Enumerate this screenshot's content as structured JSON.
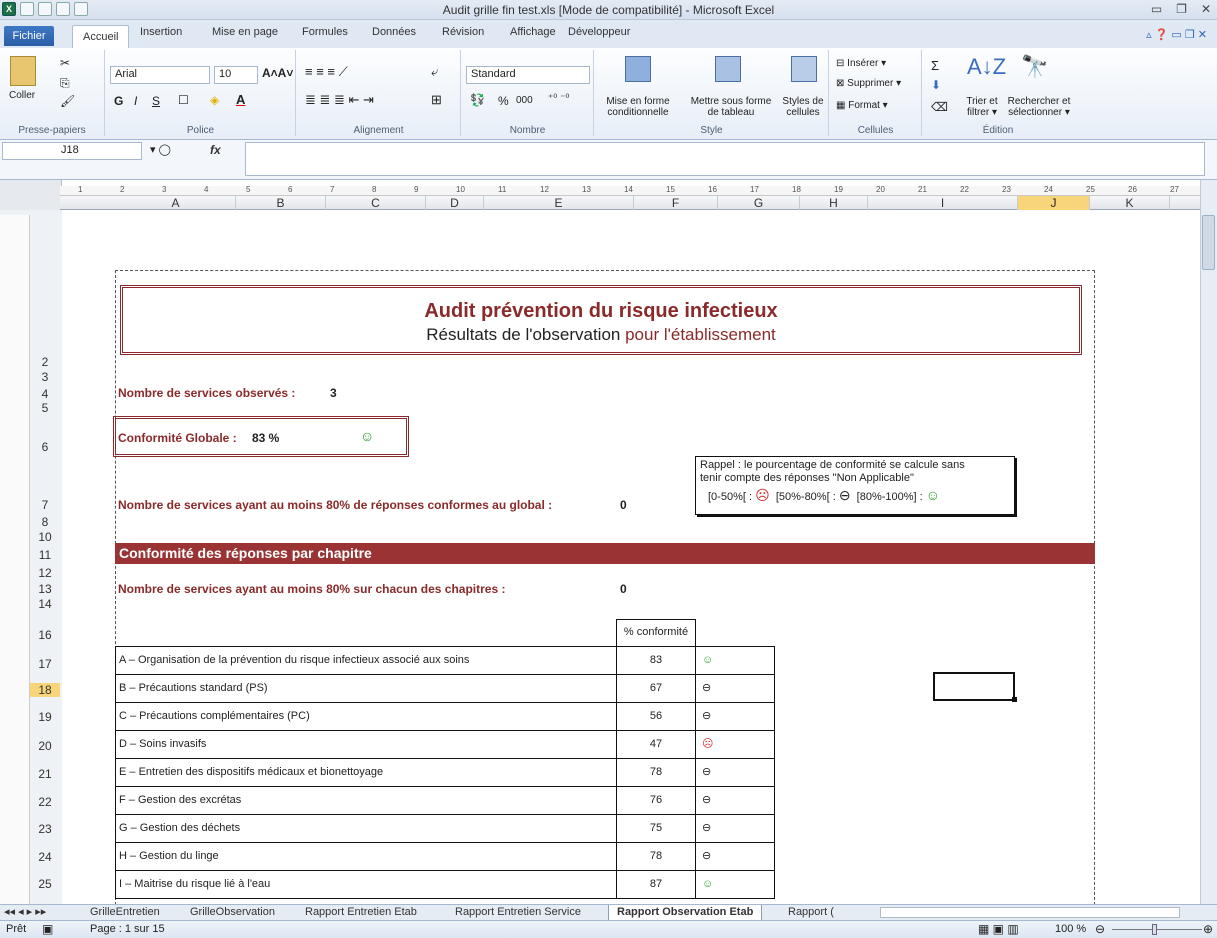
{
  "window": {
    "title": "Audit grille fin test.xls  [Mode de compatibilité]  -  Microsoft Excel"
  },
  "tabs": {
    "file": "Fichier",
    "items": [
      "Accueil",
      "Insertion",
      "Mise en page",
      "Formules",
      "Données",
      "Révision",
      "Affichage",
      "Développeur"
    ]
  },
  "ribbon": {
    "clipboard": {
      "paste": "Coller",
      "label": "Presse-papiers"
    },
    "font": {
      "name": "Arial",
      "size": "10",
      "label": "Police",
      "bold": "G",
      "italic": "I",
      "underline": "S"
    },
    "alignment": {
      "label": "Alignement"
    },
    "number": {
      "format": "Standard",
      "percent": "%",
      "thousands": "000",
      "label": "Nombre"
    },
    "style": {
      "conditional": "Mise en forme",
      "conditional2": "conditionnelle",
      "table": "Mettre sous forme",
      "table2": "de tableau",
      "cellstyles": "Styles de",
      "cellstyles2": "cellules",
      "label": "Style"
    },
    "cells": {
      "insert": "Insérer",
      "delete": "Supprimer",
      "format": "Format",
      "label": "Cellules"
    },
    "editing": {
      "sort": "Trier et",
      "sort2": "filtrer",
      "find": "Rechercher et",
      "find2": "sélectionner",
      "label": "Édition",
      "sigma": "Σ"
    }
  },
  "formula": {
    "namebox": "J18",
    "fx": "fx",
    "value": ""
  },
  "columns": [
    "A",
    "B",
    "C",
    "D",
    "E",
    "F",
    "G",
    "H",
    "I",
    "J",
    "K"
  ],
  "ruler_h": [
    "1",
    "2",
    "3",
    "4",
    "5",
    "6",
    "7",
    "8",
    "9",
    "10",
    "11",
    "12",
    "13",
    "14",
    "15",
    "16",
    "17",
    "18",
    "19",
    "20",
    "21",
    "22",
    "23",
    "24",
    "25",
    "26",
    "27"
  ],
  "rows": [
    "2",
    "3",
    "4",
    "5",
    "6",
    "7",
    "8",
    "10",
    "11",
    "12",
    "13",
    "14",
    "16",
    "17",
    "18",
    "19",
    "20",
    "21",
    "22",
    "23",
    "24",
    "25"
  ],
  "report": {
    "title": "Audit prévention du risque infectieux",
    "subtitle_a": "Résultats de l'observation ",
    "subtitle_b": "pour l'établissement",
    "services_label": "Nombre de services observés :",
    "services_value": "3",
    "conf_label": "Conformité Globale :",
    "conf_value": "83 %",
    "conf_face": "☺",
    "services80_label": "Nombre de services ayant au moins 80% de réponses conformes au global :",
    "services80_value": "0",
    "rappel_l1": "Rappel : le pourcentage de conformité se calcule sans",
    "rappel_l2": "tenir compte des réponses \"Non Applicable\"",
    "rappel_a": "[0-50%[ :",
    "rappel_b": "[50%-80%[ :",
    "rappel_c": "[80%-100%] :",
    "band": "Conformité des réponses par chapitre",
    "chap80_label": "Nombre de services ayant au moins 80% sur chacun des chapitres :",
    "chap80_value": "0",
    "col_header": "% conformité",
    "chapters": [
      {
        "label": "A – Organisation de la prévention du risque infectieux associé aux soins",
        "value": "83",
        "face": "☺",
        "tone": "green"
      },
      {
        "label": "B – Précautions standard (PS)",
        "value": "67",
        "face": "⊖",
        "tone": "black"
      },
      {
        "label": "C – Précautions complémentaires (PC)",
        "value": "56",
        "face": "⊖",
        "tone": "black"
      },
      {
        "label": "D – Soins invasifs",
        "value": "47",
        "face": "☹",
        "tone": "red"
      },
      {
        "label": "E – Entretien des dispositifs médicaux et bionettoyage",
        "value": "78",
        "face": "⊖",
        "tone": "black"
      },
      {
        "label": "F – Gestion des excrétas",
        "value": "76",
        "face": "⊖",
        "tone": "black"
      },
      {
        "label": "G – Gestion des déchets",
        "value": "75",
        "face": "⊖",
        "tone": "black"
      },
      {
        "label": "H – Gestion du linge",
        "value": "78",
        "face": "⊖",
        "tone": "black"
      },
      {
        "label": "I – Maitrise du risque lié à l'eau",
        "value": "87",
        "face": "☺",
        "tone": "green"
      }
    ]
  },
  "sheets": [
    "GrilleEntretien",
    "GrilleObservation",
    "Rapport Entretien Etab",
    "Rapport Entretien Service",
    "Rapport Observation Etab",
    "Rapport ("
  ],
  "status": {
    "ready": "Prêt",
    "page": "Page : 1 sur 15",
    "zoom": "100 %"
  },
  "colors": {
    "accent": "#8a2a2a",
    "band": "#9a3434",
    "selected": "#f8d57a"
  }
}
